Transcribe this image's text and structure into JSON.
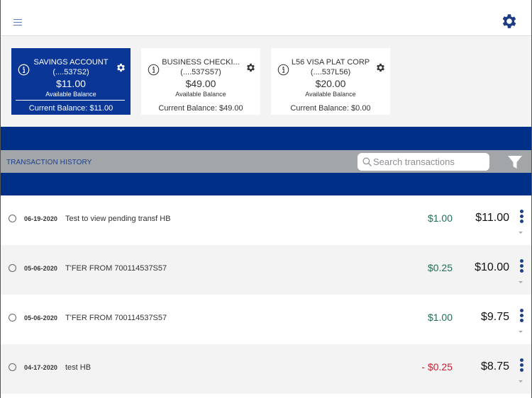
{
  "header": {
    "menu_icon": "hamburger-icon",
    "settings_icon": "gear-icon"
  },
  "accounts": [
    {
      "name": "SAVINGS ACCOUNT",
      "number": "(....537S2)",
      "balance": "$11.00",
      "balance_label": "Available Balance",
      "current_balance": "Current Balance: $11.00",
      "selected": true
    },
    {
      "name": "BUSINESS CHECKI...",
      "number": "(....537S57)",
      "balance": "$49.00",
      "balance_label": "Available Balance",
      "current_balance": "Current Balance: $49.00",
      "selected": false
    },
    {
      "name": "L56 VISA PLAT CORP",
      "number": "(....537L56)",
      "balance": "$20.00",
      "balance_label": "Available Balance",
      "current_balance": "Current Balance: $0.00",
      "selected": false
    }
  ],
  "transactions_section": {
    "title": "TRANSACTION HISTORY",
    "search_placeholder": "Search transactions",
    "search_value": "",
    "filter_icon": "filter-icon"
  },
  "transactions": [
    {
      "date": "06-19-2020",
      "description": "Test to view pending transf HB",
      "amount": "$1.00",
      "amount_type": "credit",
      "balance": "$11.00"
    },
    {
      "date": "05-06-2020",
      "description": "T'FER FROM 700114537S57",
      "amount": "$0.25",
      "amount_type": "credit",
      "balance": "$10.00"
    },
    {
      "date": "05-06-2020",
      "description": "T'FER FROM 700114537S57",
      "amount": "$1.00",
      "amount_type": "credit",
      "balance": "$9.75"
    },
    {
      "date": "04-17-2020",
      "description": "test HB",
      "amount": "- $0.25",
      "amount_type": "debit",
      "balance": "$8.75"
    }
  ],
  "colors": {
    "brand_blue": "#002f87",
    "selected_card": "#0a3697",
    "credit_green": "#1f6e58",
    "debit_red": "#c8202f",
    "header_gray": "#a2a6a9"
  }
}
